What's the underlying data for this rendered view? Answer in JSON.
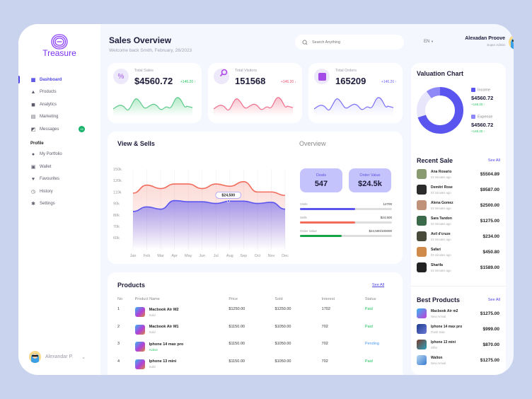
{
  "app": {
    "brand": "Treasure"
  },
  "sidebar": {
    "items": [
      {
        "label": "Dashboard",
        "icon": "dashboard-icon",
        "active": true
      },
      {
        "label": "Products",
        "icon": "bag-icon"
      },
      {
        "label": "Analytics",
        "icon": "analytics-icon"
      },
      {
        "label": "Marketing",
        "icon": "cart-icon"
      },
      {
        "label": "Messages",
        "icon": "message-icon",
        "badge": "15"
      }
    ],
    "profile_section": "Profile",
    "profile_items": [
      {
        "label": "My Portfolio",
        "icon": "user-icon"
      },
      {
        "label": "Wallet",
        "icon": "wallet-icon"
      },
      {
        "label": "Favourites",
        "icon": "heart-icon"
      },
      {
        "label": "History",
        "icon": "clock-icon"
      },
      {
        "label": "Settings",
        "icon": "gear-icon"
      }
    ],
    "user": {
      "name": "Alexandar P."
    }
  },
  "header": {
    "title": "Sales Overview",
    "subtitle": "Welcome back Smith, February, 28/2023",
    "search_placeholder": "Search Anything",
    "language": "EN",
    "user_name": "Alexadan Proove",
    "user_role": "Super Admin"
  },
  "stats": [
    {
      "label": "Total Sales",
      "value": "$4560.72",
      "change": "+146.20 ↑",
      "color": "#22c55e"
    },
    {
      "label": "Total Visitors",
      "value": "151568",
      "change": "+146.20 ↓",
      "color": "#f0506e"
    },
    {
      "label": "Total Orders",
      "value": "165209",
      "change": "+146.20 ↑",
      "color": "#6c63ff"
    }
  ],
  "valuation": {
    "title": "Valuation Chart",
    "income_label": "Income",
    "income_value": "$4560.72",
    "income_change": "+146.20 ↑",
    "expense_label": "Expense",
    "expense_value": "$4560.72",
    "expense_change": "+146.20 ↑",
    "income_share": 0.7,
    "expense_share": 0.1,
    "other_share": 0.2
  },
  "view_sells": {
    "title": "View & Sells",
    "tooltip": "$24,500"
  },
  "chart_data": {
    "type": "area",
    "title": "View & Sells",
    "categories": [
      "Jan",
      "Feb",
      "Mar",
      "Apr",
      "May",
      "Jun",
      "Jul",
      "Aug",
      "Sep",
      "Oct",
      "Nov",
      "Dec"
    ],
    "yticks": [
      "150k",
      "120k",
      "110k",
      "90k",
      "80k",
      "70k",
      "60k"
    ],
    "series": [
      {
        "name": "Views",
        "color": "#f26b5b",
        "values": [
          108,
          116,
          113,
          117,
          117,
          113,
          117,
          115,
          119,
          110,
          110,
          104
        ]
      },
      {
        "name": "Sells",
        "color": "#5b55f0",
        "values": [
          83,
          87,
          85,
          95,
          93,
          93,
          90,
          94,
          94,
          90,
          92,
          85
        ]
      }
    ],
    "tooltip": {
      "category": "Aug",
      "label": "$24,500"
    },
    "grid": true
  },
  "overview": {
    "title": "Overview",
    "deals_label": "Deals",
    "deals_value": "547",
    "order_label": "Order Value",
    "order_value": "$24.5k",
    "bars": [
      {
        "label": "Visits",
        "value": "12700",
        "fraction": 0.6,
        "color": "#5b55f0"
      },
      {
        "label": "Sells",
        "value": "$24,500",
        "fraction": 0.6,
        "color": "#f26b5b"
      },
      {
        "label": "Order Value",
        "value": "$24,500/100000",
        "fraction": 0.45,
        "color": "#16a34a"
      }
    ]
  },
  "products": {
    "title": "Products",
    "see_all": "See All",
    "columns": [
      "No",
      "Product Name",
      "Price",
      "Sold",
      "Interest",
      "Status"
    ],
    "rows": [
      {
        "no": "1",
        "name": "Macbook Air M2",
        "sub": "Sold",
        "price": "$1250.00",
        "sold": "$1250.00",
        "interest": "1702",
        "status": "Paid"
      },
      {
        "no": "2",
        "name": "Macbook Air M1",
        "sub": "Sold",
        "price": "$1150.00",
        "sold": "$1050.00",
        "interest": "702",
        "status": "Paid"
      },
      {
        "no": "3",
        "name": "Iphone 14 max pro",
        "sub": "Active",
        "price": "$1150.00",
        "sold": "$1050.00",
        "interest": "702",
        "status": "Pending"
      },
      {
        "no": "4",
        "name": "Iphone 13 mini",
        "sub": "Sold",
        "price": "$1150.00",
        "sold": "$1050.00",
        "interest": "702",
        "status": "Paid"
      }
    ]
  },
  "recent_sale": {
    "title": "Recent Sale",
    "see_all": "See All",
    "items": [
      {
        "name": "Ana Rosario",
        "time": "02 minutes ago",
        "amount": "$5504.89"
      },
      {
        "name": "Demitri Rose",
        "time": "02 minutes ago",
        "amount": "$9587.00"
      },
      {
        "name": "Alena Gomez",
        "time": "02 minutes ago",
        "amount": "$2500.00"
      },
      {
        "name": "Sara Tandon",
        "time": "02 minutes ago",
        "amount": "$1275.00"
      },
      {
        "name": "Avil d'cruze",
        "time": "02 minutes ago",
        "amount": "$234.00"
      },
      {
        "name": "Safari",
        "time": "02 minutes ago",
        "amount": "$450.80"
      },
      {
        "name": "Sharifa",
        "time": "02 minutes ago",
        "amount": "$1589.00"
      }
    ]
  },
  "best_products": {
    "title": "Best Products",
    "see_all": "See All",
    "items": [
      {
        "name": "Macbook Air m2",
        "tag": "New Arrival",
        "amount": "$1275.00"
      },
      {
        "name": "Iphone 14 max pro",
        "tag": "Flash Sale",
        "amount": "$999.00"
      },
      {
        "name": "Iphone 13 mini",
        "tag": "Offer",
        "amount": "$870.00"
      },
      {
        "name": "Walton",
        "tag": "New Arrival",
        "amount": "$1275.00"
      }
    ]
  }
}
